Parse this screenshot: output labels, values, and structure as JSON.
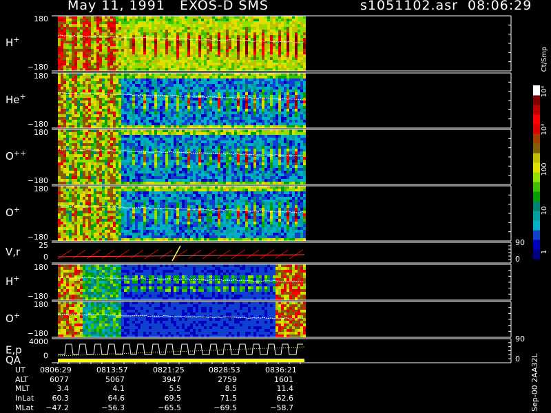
{
  "header": {
    "title_left": "May 11, 1991   EXOS-D SMS",
    "title_right": "s1051102.asr  08:06:29"
  },
  "chart_data": {
    "type": "heatmap",
    "colorbar": {
      "label": "Ct/Smp",
      "ticks": [
        "10⁴",
        "10³",
        "100",
        "10",
        "1"
      ],
      "colors": [
        "#000080",
        "#0000c0",
        "#1040d0",
        "#00b0c8",
        "#00a0a0",
        "#008070",
        "#00a000",
        "#40c000",
        "#90e000",
        "#e0e000",
        "#c0c000",
        "#806000",
        "#a04000",
        "#e00000",
        "#ff0000",
        "#c00000",
        "#800000",
        "#ffffff"
      ]
    },
    "panels": [
      {
        "id": "h-plus",
        "label": "H",
        "sup": "+",
        "ymax": "180",
        "ymin": "−180"
      },
      {
        "id": "he-plus",
        "label": "He",
        "sup": "+",
        "ymax": "180",
        "ymin": "−180"
      },
      {
        "id": "o-plusplus",
        "label": "O",
        "sup": "++",
        "ymax": "180",
        "ymin": "−180"
      },
      {
        "id": "o-plus",
        "label": "O",
        "sup": "+",
        "ymax": "180",
        "ymin": "−180"
      },
      {
        "id": "vr",
        "label": "V,r",
        "ymax": "25",
        "ymid": "0",
        "right_top": "90",
        "right_bottom": "0"
      },
      {
        "id": "h-plus-2",
        "label": "H",
        "sup": "+",
        "ymax": "180",
        "ymin": "−180"
      },
      {
        "id": "o-plus-2",
        "label": "O",
        "sup": "+",
        "ymax": "180",
        "ymin": "−180"
      },
      {
        "id": "ep",
        "label": "E,p",
        "label2": "QA",
        "ymax": "4000",
        "ymid": "0",
        "right_top": "90",
        "right_bottom": "0"
      }
    ]
  },
  "ephemeris": {
    "labels": [
      "UT",
      "ALT",
      "MLT",
      "InLat",
      "MLat"
    ],
    "columns": [
      {
        "UT": "0806:29",
        "ALT": "6077",
        "MLT": "3.4",
        "InLat": "60.3",
        "MLat": "−47.2"
      },
      {
        "UT": "0813:57",
        "ALT": "5067",
        "MLT": "4.1",
        "InLat": "64.6",
        "MLat": "−56.3"
      },
      {
        "UT": "0821:25",
        "ALT": "3947",
        "MLT": "5.5",
        "InLat": "69.5",
        "MLat": "−65.5"
      },
      {
        "UT": "0828:53",
        "ALT": "2759",
        "MLT": "8.5",
        "InLat": "71.5",
        "MLat": "−69.5"
      },
      {
        "UT": "0836:21",
        "ALT": "1601",
        "MLT": "11.4",
        "InLat": "62.6",
        "MLat": "−58.7"
      }
    ]
  },
  "footer": {
    "vertical_note": "Sep-00  2AA32L"
  }
}
